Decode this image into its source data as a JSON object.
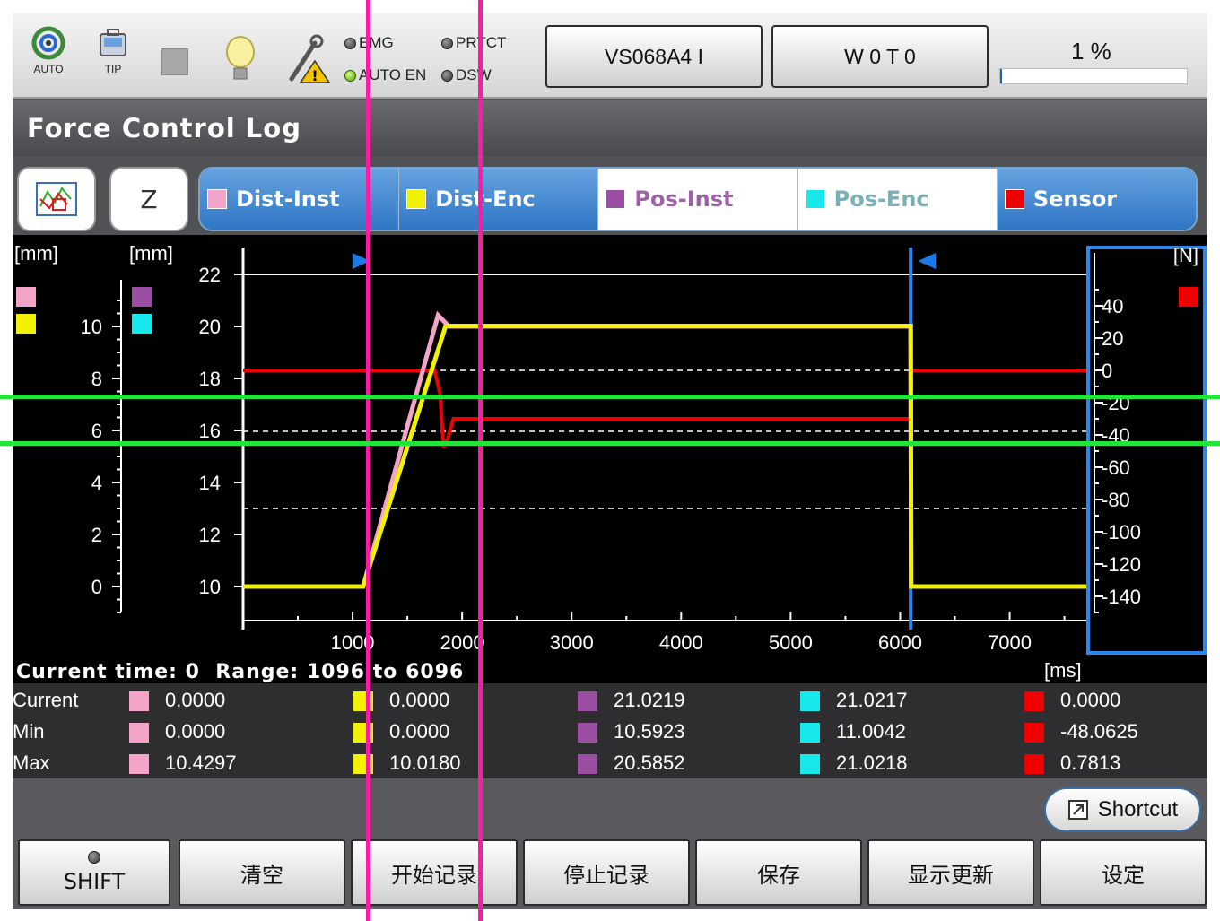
{
  "status": {
    "auto_label": "AUTO",
    "tip_label": "TIP",
    "leds": {
      "emg": "EMG",
      "prtct": "PRTCT",
      "auto_en": "AUTO EN",
      "dsw": "DSW"
    },
    "robot_button": "VS068A4 I",
    "tool_button": "W 0 T 0",
    "speed_text": "1 %",
    "speed_fraction": 0.01
  },
  "title": "Force Control Log",
  "toolbar": {
    "axis_button": "Z"
  },
  "legend": [
    {
      "label": "Dist-Inst",
      "color": "#f4a4c8",
      "active": true
    },
    {
      "label": "Dist-Enc",
      "color": "#f2f200",
      "active": true
    },
    {
      "label": "Pos-Inst",
      "color": "#9b4fa2",
      "active": false
    },
    {
      "label": "Pos-Enc",
      "color": "#16e8ec",
      "active": false
    },
    {
      "label": "Sensor",
      "color": "#ee0000",
      "active": true
    }
  ],
  "chart_data": {
    "type": "line",
    "x_unit": "[ms]",
    "x_ticks": [
      1000,
      2000,
      3000,
      4000,
      5000,
      6000,
      7000
    ],
    "xlim": [
      0,
      7700
    ],
    "range_start": 1096,
    "range_end": 6096,
    "left_axis_unit": "[mm]",
    "left_axis_ticks": [
      0,
      2,
      4,
      6,
      8,
      10
    ],
    "mid_axis_unit": "[mm]",
    "mid_axis_ticks": [
      10,
      12,
      14,
      16,
      18,
      20,
      22
    ],
    "right_axis_unit": "[N]",
    "right_axis_ticks": [
      40,
      20,
      0,
      -20,
      -40,
      -60,
      -80,
      -100,
      -120,
      -140
    ],
    "series": [
      {
        "name": "Dist-Inst",
        "color": "#f4a4c8",
        "axis": "mm",
        "x": [
          0,
          1096,
          1780,
          1880,
          6096,
          6100,
          7700
        ],
        "y": [
          0,
          0,
          10.4297,
          10.0,
          10.0,
          0,
          0
        ]
      },
      {
        "name": "Dist-Enc",
        "color": "#f2f200",
        "axis": "mm",
        "x": [
          0,
          1096,
          1850,
          6096,
          6100,
          7700
        ],
        "y": [
          0,
          0,
          10.018,
          10.018,
          0,
          0
        ]
      },
      {
        "name": "Sensor",
        "color": "#ee0000",
        "axis": "N",
        "x": [
          0,
          1750,
          1800,
          1830,
          1870,
          1920,
          6096,
          6100,
          7700
        ],
        "y": [
          0,
          0,
          -15,
          -48.0625,
          -42,
          -30,
          -30,
          0,
          0
        ]
      }
    ]
  },
  "info": {
    "current_time_label": "Current time:",
    "current_time": "0",
    "range_label": "Range:",
    "range_from": "1096",
    "to_label": "to",
    "range_to": "6096"
  },
  "stats": {
    "row_labels": [
      "Current",
      "Min",
      "Max"
    ],
    "columns": [
      {
        "color": "#f4a4c8",
        "values": [
          "0.0000",
          "0.0000",
          "10.4297"
        ]
      },
      {
        "color": "#f2f200",
        "values": [
          "0.0000",
          "0.0000",
          "10.0180"
        ]
      },
      {
        "color": "#9b4fa2",
        "values": [
          "21.0219",
          "10.5923",
          "20.5852"
        ]
      },
      {
        "color": "#16e8ec",
        "values": [
          "21.0217",
          "11.0042",
          "21.0218"
        ]
      },
      {
        "color": "#ee0000",
        "values": [
          "0.0000",
          "-48.0625",
          "0.7813"
        ]
      }
    ]
  },
  "shortcut_label": "Shortcut",
  "function_buttons": [
    "SHIFT",
    "清空",
    "开始记录",
    "停止记录",
    "保存",
    "显示更新",
    "设定"
  ]
}
